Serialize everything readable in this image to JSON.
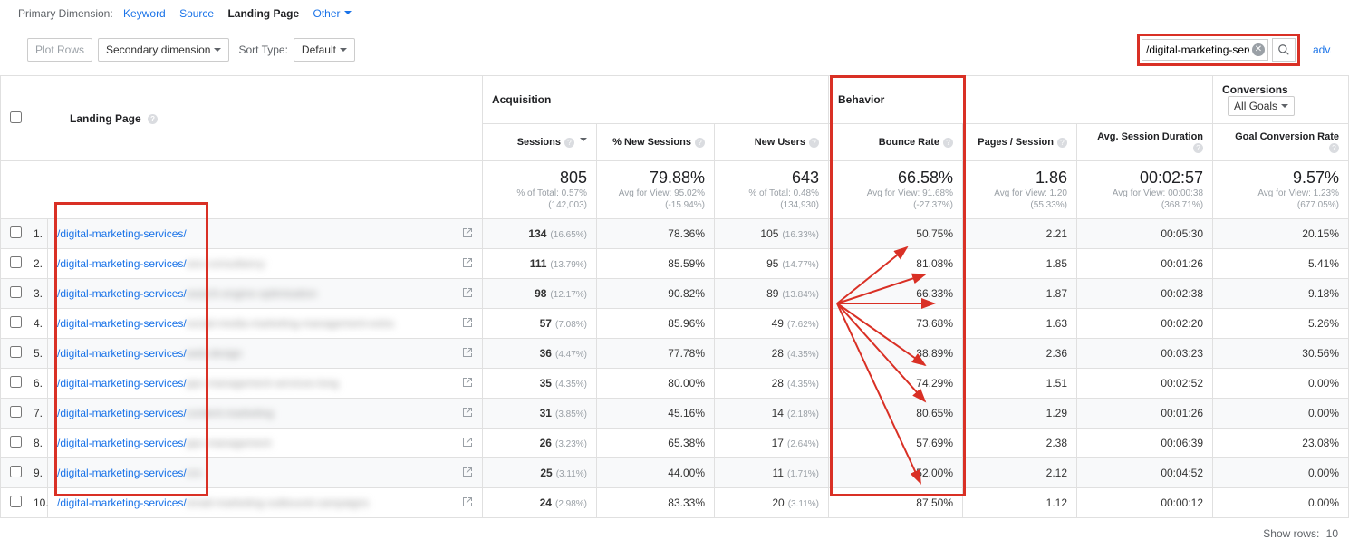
{
  "primaryDimension": {
    "label": "Primary Dimension:",
    "items": [
      "Keyword",
      "Source",
      "Landing Page",
      "Other"
    ],
    "active": "Landing Page"
  },
  "controls": {
    "plotRows": "Plot Rows",
    "secondaryDimension": "Secondary dimension",
    "sortTypeLabel": "Sort Type:",
    "sortTypeValue": "Default",
    "searchValue": "/digital-marketing-servic",
    "advanced": "advanced"
  },
  "headers": {
    "landingPage": "Landing Page",
    "groups": {
      "acquisition": "Acquisition",
      "behavior": "Behavior",
      "conversions": "Conversions",
      "conversionsGoal": "All Goals"
    },
    "sub": {
      "sessions": "Sessions",
      "pctNewSessions": "% New Sessions",
      "newUsers": "New Users",
      "bounceRate": "Bounce Rate",
      "pagesSession": "Pages / Session",
      "avgDuration": "Avg. Session Duration",
      "goalConvRate": "Goal Conversion Rate"
    }
  },
  "summary": {
    "sessions": {
      "big": "805",
      "line1": "% of Total: 0.57%",
      "line2": "(142,003)"
    },
    "pctNewSessions": {
      "big": "79.88%",
      "line1": "Avg for View: 95.02%",
      "line2": "(-15.94%)"
    },
    "newUsers": {
      "big": "643",
      "line1": "% of Total: 0.48%",
      "line2": "(134,930)"
    },
    "bounceRate": {
      "big": "66.58%",
      "line1": "Avg for View: 91.68%",
      "line2": "(-27.37%)"
    },
    "pagesSession": {
      "big": "1.86",
      "line1": "Avg for View: 1.20",
      "line2": "(55.33%)"
    },
    "avgDuration": {
      "big": "00:02:57",
      "line1": "Avg for View: 00:00:38",
      "line2": "(368.71%)"
    },
    "goalConvRate": {
      "big": "9.57%",
      "line1": "Avg for View: 1.23%",
      "line2": "(677.05%)"
    }
  },
  "rows": [
    {
      "n": "1.",
      "page": "/digital-marketing-services/",
      "blurred": "",
      "sessions": "134",
      "sessionsPct": "(16.65%)",
      "pctNew": "78.36%",
      "newUsers": "105",
      "newUsersPct": "(16.33%)",
      "bounce": "50.75%",
      "pages": "2.21",
      "dur": "00:05:30",
      "goal": "20.15%"
    },
    {
      "n": "2.",
      "page": "/digital-marketing-services/",
      "blurred": "seo-consultancy",
      "sessions": "111",
      "sessionsPct": "(13.79%)",
      "pctNew": "85.59%",
      "newUsers": "95",
      "newUsersPct": "(14.77%)",
      "bounce": "81.08%",
      "pages": "1.85",
      "dur": "00:01:26",
      "goal": "5.41%"
    },
    {
      "n": "3.",
      "page": "/digital-marketing-services/",
      "blurred": "search-engine-optimisation",
      "sessions": "98",
      "sessionsPct": "(12.17%)",
      "pctNew": "90.82%",
      "newUsers": "89",
      "newUsersPct": "(13.84%)",
      "bounce": "66.33%",
      "pages": "1.87",
      "dur": "00:02:38",
      "goal": "9.18%"
    },
    {
      "n": "4.",
      "page": "/digital-marketing-services/",
      "blurred": "social-media-marketing-management-extra",
      "sessions": "57",
      "sessionsPct": "(7.08%)",
      "pctNew": "85.96%",
      "newUsers": "49",
      "newUsersPct": "(7.62%)",
      "bounce": "73.68%",
      "pages": "1.63",
      "dur": "00:02:20",
      "goal": "5.26%"
    },
    {
      "n": "5.",
      "page": "/digital-marketing-services/",
      "blurred": "web-design",
      "sessions": "36",
      "sessionsPct": "(4.47%)",
      "pctNew": "77.78%",
      "newUsers": "28",
      "newUsersPct": "(4.35%)",
      "bounce": "38.89%",
      "pages": "2.36",
      "dur": "00:03:23",
      "goal": "30.56%"
    },
    {
      "n": "6.",
      "page": "/digital-marketing-services/",
      "blurred": "ppc-management-services-long",
      "sessions": "35",
      "sessionsPct": "(4.35%)",
      "pctNew": "80.00%",
      "newUsers": "28",
      "newUsersPct": "(4.35%)",
      "bounce": "74.29%",
      "pages": "1.51",
      "dur": "00:02:52",
      "goal": "0.00%"
    },
    {
      "n": "7.",
      "page": "/digital-marketing-services/",
      "blurred": "content-marketing",
      "sessions": "31",
      "sessionsPct": "(3.85%)",
      "pctNew": "45.16%",
      "newUsers": "14",
      "newUsersPct": "(2.18%)",
      "bounce": "80.65%",
      "pages": "1.29",
      "dur": "00:01:26",
      "goal": "0.00%"
    },
    {
      "n": "8.",
      "page": "/digital-marketing-services/",
      "blurred": "ppc-management",
      "sessions": "26",
      "sessionsPct": "(3.23%)",
      "pctNew": "65.38%",
      "newUsers": "17",
      "newUsersPct": "(2.64%)",
      "bounce": "57.69%",
      "pages": "2.38",
      "dur": "00:06:39",
      "goal": "23.08%"
    },
    {
      "n": "9.",
      "page": "/digital-marketing-services/",
      "blurred": "cro",
      "sessions": "25",
      "sessionsPct": "(3.11%)",
      "pctNew": "44.00%",
      "newUsers": "11",
      "newUsersPct": "(1.71%)",
      "bounce": "52.00%",
      "pages": "2.12",
      "dur": "00:04:52",
      "goal": "0.00%"
    },
    {
      "n": "10.",
      "page": "/digital-marketing-services/",
      "blurred": "email-marketing-outbound-campaigns",
      "sessions": "24",
      "sessionsPct": "(2.98%)",
      "pctNew": "83.33%",
      "newUsers": "20",
      "newUsersPct": "(3.11%)",
      "bounce": "87.50%",
      "pages": "1.12",
      "dur": "00:00:12",
      "goal": "0.00%"
    }
  ],
  "footer": {
    "showRowsLabel": "Show rows:",
    "showRowsVal": "10"
  }
}
